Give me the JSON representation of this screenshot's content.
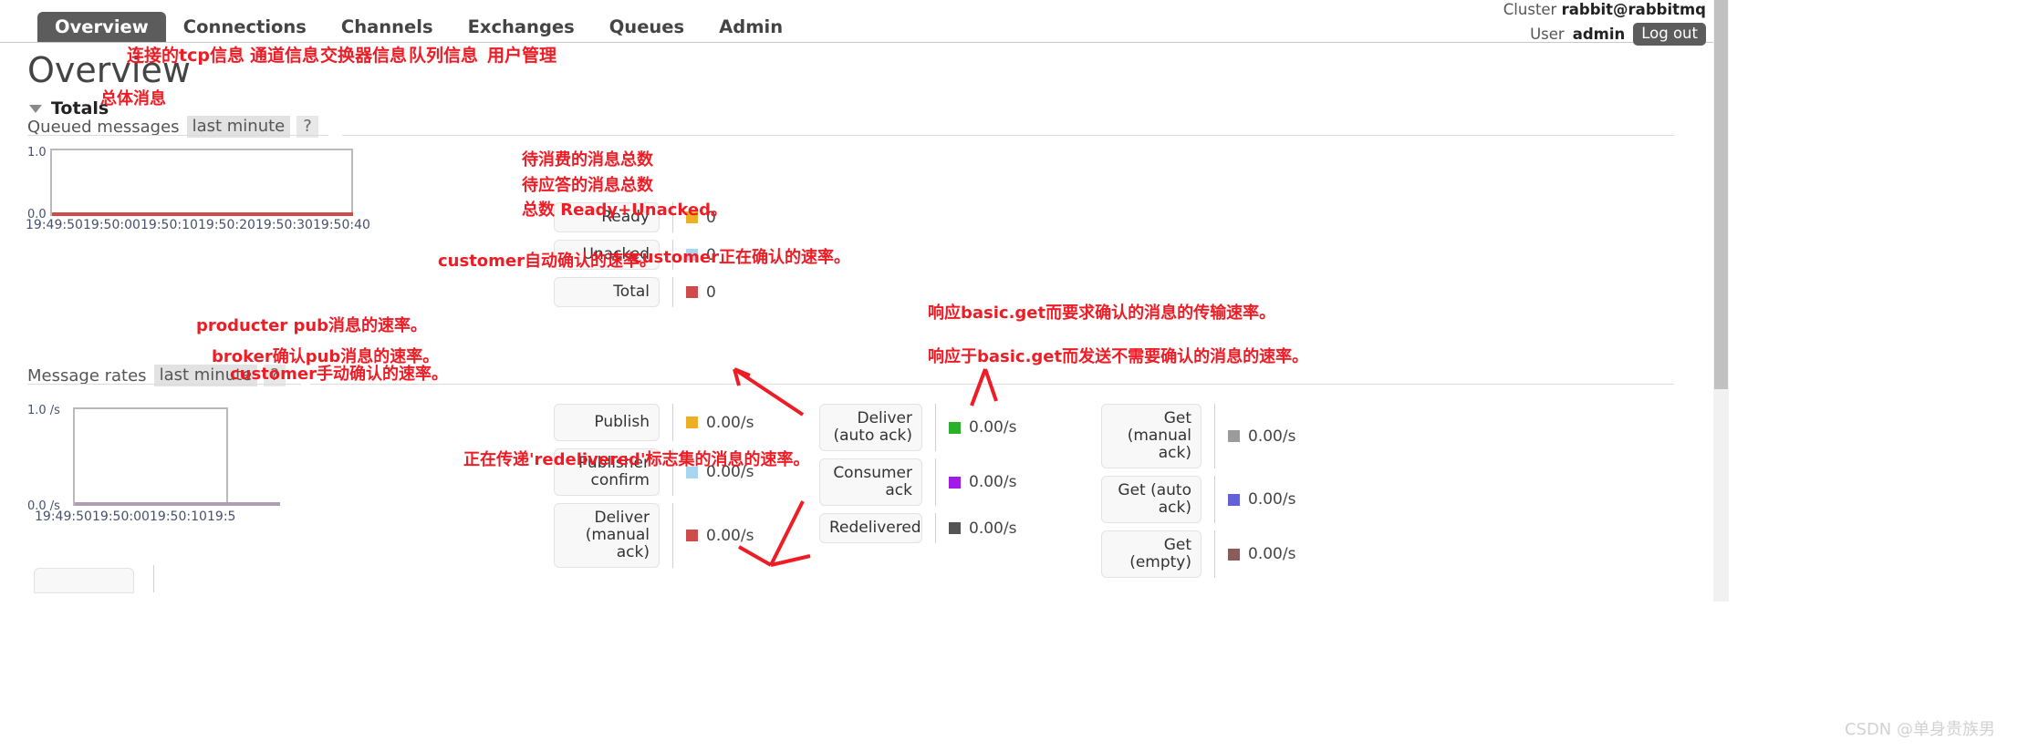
{
  "window": {
    "watermark": "CSDN @单身贵族男"
  },
  "topnav": {
    "tabs": [
      {
        "label": "Overview",
        "active": true
      },
      {
        "label": "Connections",
        "active": false
      },
      {
        "label": "Channels",
        "active": false
      },
      {
        "label": "Exchanges",
        "active": false
      },
      {
        "label": "Queues",
        "active": false
      },
      {
        "label": "Admin",
        "active": false
      }
    ],
    "cluster_label": "Cluster",
    "cluster_name": "rabbit@rabbitmq",
    "user_label": "User",
    "user_name": "admin",
    "logout_label": "Log out"
  },
  "page": {
    "title": "Overview"
  },
  "totals": {
    "section_label": "Totals",
    "queued": {
      "label": "Queued messages",
      "period": "last minute",
      "help": "?"
    },
    "rates": {
      "label": "Message rates",
      "period": "last minute",
      "help": "?"
    }
  },
  "queued_legend": [
    {
      "name": "Ready",
      "color": "#edb024",
      "value": "0"
    },
    {
      "name": "Unacked",
      "color": "#a8d6f0",
      "value": "0"
    },
    {
      "name": "Total",
      "color": "#cf4b4b",
      "value": "0"
    }
  ],
  "rates_col1": [
    {
      "name": "Publish",
      "color": "#edb024",
      "value": "0.00/s"
    },
    {
      "name": "Publisher confirm",
      "color": "#a8d6f0",
      "value": "0.00/s"
    },
    {
      "name": "Deliver (manual ack)",
      "color": "#cf4b4b",
      "value": "0.00/s"
    }
  ],
  "rates_col2": [
    {
      "name": "Deliver (auto ack)",
      "color": "#2ab02a",
      "value": "0.00/s"
    },
    {
      "name": "Consumer ack",
      "color": "#a01ae8",
      "value": "0.00/s"
    },
    {
      "name": "Redelivered",
      "color": "#555555",
      "value": "0.00/s"
    }
  ],
  "rates_col3": [
    {
      "name": "Get (manual ack)",
      "color": "#9b9b9b",
      "value": "0.00/s"
    },
    {
      "name": "Get (auto ack)",
      "color": "#6160d8",
      "value": "0.00/s"
    },
    {
      "name": "Get (empty)",
      "color": "#8a5b5b",
      "value": "0.00/s"
    }
  ],
  "annotations": [
    {
      "id": "nav-connections",
      "text": "连接的tcp信息"
    },
    {
      "id": "nav-channels",
      "text": "通道信息"
    },
    {
      "id": "nav-exchanges",
      "text": "交换器信息"
    },
    {
      "id": "nav-queues",
      "text": "队列信息"
    },
    {
      "id": "nav-admin",
      "text": "用户管理"
    },
    {
      "id": "totals",
      "text": "总体消息"
    },
    {
      "id": "ready",
      "text": "待消费的消息总数"
    },
    {
      "id": "unacked",
      "text": "待应答的消息总数"
    },
    {
      "id": "total",
      "text": "总数 Ready+Unacked。"
    },
    {
      "id": "deliver-auto-ack",
      "text": "customer自动确认的速率。"
    },
    {
      "id": "consumer-ack",
      "text": "customer正在确认的速率。"
    },
    {
      "id": "publish",
      "text": "producter pub消息的速率。"
    },
    {
      "id": "publisher-confirm",
      "text": "broker确认pub消息的速率。"
    },
    {
      "id": "deliver-manual-ack",
      "text": "customer手动确认的速率。"
    },
    {
      "id": "get-manual-ack",
      "text": "响应basic.get而要求确认的消息的传输速率。"
    },
    {
      "id": "get-auto-ack",
      "text": "响应于basic.get而发送不需要确认的消息的速率。"
    },
    {
      "id": "redelivered",
      "text": "正在传递'redelivered'标志集的消息的速率。"
    }
  ],
  "chart_data": [
    {
      "type": "line",
      "title": "Queued messages",
      "subtitle": "last minute",
      "xlabel": "",
      "ylabel": "",
      "ylim": [
        0.0,
        1.0
      ],
      "ytick_labels": [
        "1.0",
        "0.0"
      ],
      "xtick_labels": [
        "19:49:50",
        "19:50:00",
        "19:50:10",
        "19:50:20",
        "19:50:30",
        "19:50:40"
      ],
      "grid": false,
      "legend_position": "right",
      "series": [
        {
          "name": "Ready",
          "color": "#edb024",
          "values": [
            0,
            0,
            0,
            0,
            0,
            0
          ],
          "current": 0
        },
        {
          "name": "Unacked",
          "color": "#a8d6f0",
          "values": [
            0,
            0,
            0,
            0,
            0,
            0
          ],
          "current": 0
        },
        {
          "name": "Total",
          "color": "#cf4b4b",
          "values": [
            0,
            0,
            0,
            0,
            0,
            0
          ],
          "current": 0
        }
      ]
    },
    {
      "type": "line",
      "title": "Message rates",
      "subtitle": "last minute",
      "xlabel": "",
      "ylabel": "/s",
      "ylim": [
        0.0,
        1.0
      ],
      "ytick_labels": [
        "1.0 /s",
        "0.0 /s"
      ],
      "xtick_labels": [
        "19:49:50",
        "19:50:00",
        "19:50:10",
        "19:5"
      ],
      "grid": false,
      "legend_position": "right",
      "series": [
        {
          "name": "Publish",
          "color": "#edb024",
          "values": [
            0,
            0,
            0,
            0
          ],
          "current": "0.00/s"
        },
        {
          "name": "Publisher confirm",
          "color": "#a8d6f0",
          "values": [
            0,
            0,
            0,
            0
          ],
          "current": "0.00/s"
        },
        {
          "name": "Deliver (manual ack)",
          "color": "#cf4b4b",
          "values": [
            0,
            0,
            0,
            0
          ],
          "current": "0.00/s"
        },
        {
          "name": "Deliver (auto ack)",
          "color": "#2ab02a",
          "values": [
            0,
            0,
            0,
            0
          ],
          "current": "0.00/s"
        },
        {
          "name": "Consumer ack",
          "color": "#a01ae8",
          "values": [
            0,
            0,
            0,
            0
          ],
          "current": "0.00/s"
        },
        {
          "name": "Redelivered",
          "color": "#555555",
          "values": [
            0,
            0,
            0,
            0
          ],
          "current": "0.00/s"
        },
        {
          "name": "Get (manual ack)",
          "color": "#9b9b9b",
          "values": [
            0,
            0,
            0,
            0
          ],
          "current": "0.00/s"
        },
        {
          "name": "Get (auto ack)",
          "color": "#6160d8",
          "values": [
            0,
            0,
            0,
            0
          ],
          "current": "0.00/s"
        },
        {
          "name": "Get (empty)",
          "color": "#8a5b5b",
          "values": [
            0,
            0,
            0,
            0
          ],
          "current": "0.00/s"
        }
      ]
    }
  ]
}
